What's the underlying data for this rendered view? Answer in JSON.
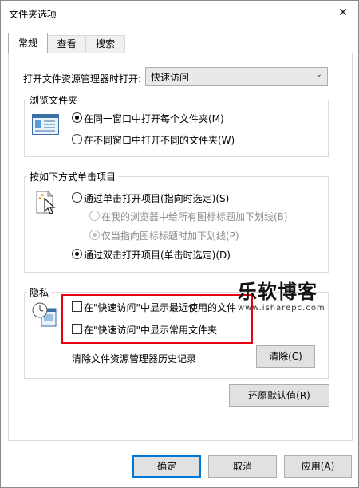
{
  "window": {
    "title": "文件夹选项",
    "close_glyph": "✕"
  },
  "tabs": [
    {
      "label": "常规"
    },
    {
      "label": "查看"
    },
    {
      "label": "搜索"
    }
  ],
  "general": {
    "open_explorer_label": "打开文件资源管理器时打开:",
    "open_explorer_value": "快速访问",
    "browse_group": {
      "title": "浏览文件夹",
      "options": [
        {
          "label": "在同一窗口中打开每个文件夹(M)",
          "checked": true
        },
        {
          "label": "在不同窗口中打开不同的文件夹(W)",
          "checked": false
        }
      ]
    },
    "click_group": {
      "title": "按如下方式单击项目",
      "single_click": {
        "label": "通过单击打开项目(指向时选定)(S)",
        "checked": false
      },
      "underline_options": [
        {
          "label": "在我的浏览器中给所有图标标题加下划线(B)",
          "checked": false,
          "disabled": true
        },
        {
          "label": "仅当指向图标标题时加下划线(P)",
          "checked": true,
          "disabled": true
        }
      ],
      "double_click": {
        "label": "通过双击打开项目(单击时选定)(D)",
        "checked": true
      }
    },
    "privacy_group": {
      "title": "隐私",
      "checkboxes": [
        {
          "label": "在\"快速访问\"中显示最近使用的文件",
          "checked": false
        },
        {
          "label": "在\"快速访问\"中显示常用文件夹",
          "checked": false
        }
      ],
      "clear_label": "清除文件资源管理器历史记录",
      "clear_button": "清除(C)"
    },
    "restore_button": "还原默认值(R)"
  },
  "footer": {
    "ok": "确定",
    "cancel": "取消",
    "apply": "应用(A)"
  },
  "watermark": {
    "main": "乐软博客",
    "sub": "www.isharepc.com"
  },
  "colors": {
    "highlight_box": "#e60012",
    "primary_border": "#0078d7"
  }
}
